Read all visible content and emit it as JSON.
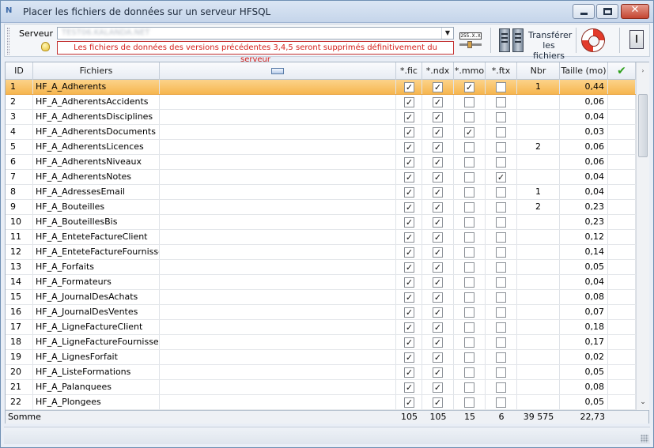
{
  "window": {
    "title": "Placer les fichiers de données sur un serveur HFSQL",
    "icon": "app-icon"
  },
  "toolbar": {
    "server_label": "Serveur",
    "server_value": "TEST06.KALANDA.NET",
    "warning": "Les fichiers de données des versions précédentes 3,4,5 seront supprimés définitivement du serveur",
    "ip_label": "255.X.X",
    "transfer_label_line1": "Transférer",
    "transfer_label_line2": "les fichiers"
  },
  "grid": {
    "columns": {
      "id": "ID",
      "name": "Fichiers",
      "fic": "*.fic",
      "ndx": "*.ndx",
      "mmo": "*.mmo",
      "ftx": "*.ftx",
      "nbr": "Nbr",
      "size": "Taille (mo)"
    },
    "rows": [
      {
        "id": "1",
        "name": "HF_A_Adherents",
        "fic": true,
        "ndx": true,
        "mmo": true,
        "ftx": false,
        "nbr": "1",
        "size": "0,44",
        "selected": true
      },
      {
        "id": "2",
        "name": "HF_A_AdherentsAccidents",
        "fic": true,
        "ndx": true,
        "mmo": false,
        "ftx": false,
        "nbr": "",
        "size": "0,06"
      },
      {
        "id": "3",
        "name": "HF_A_AdherentsDisciplines",
        "fic": true,
        "ndx": true,
        "mmo": false,
        "ftx": false,
        "nbr": "",
        "size": "0,04"
      },
      {
        "id": "4",
        "name": "HF_A_AdherentsDocuments",
        "fic": true,
        "ndx": true,
        "mmo": true,
        "ftx": false,
        "nbr": "",
        "size": "0,03"
      },
      {
        "id": "5",
        "name": "HF_A_AdherentsLicences",
        "fic": true,
        "ndx": true,
        "mmo": false,
        "ftx": false,
        "nbr": "2",
        "size": "0,06"
      },
      {
        "id": "6",
        "name": "HF_A_AdherentsNiveaux",
        "fic": true,
        "ndx": true,
        "mmo": false,
        "ftx": false,
        "nbr": "",
        "size": "0,06"
      },
      {
        "id": "7",
        "name": "HF_A_AdherentsNotes",
        "fic": true,
        "ndx": true,
        "mmo": false,
        "ftx": true,
        "nbr": "",
        "size": "0,04"
      },
      {
        "id": "8",
        "name": "HF_A_AdressesEmail",
        "fic": true,
        "ndx": true,
        "mmo": false,
        "ftx": false,
        "nbr": "1",
        "size": "0,04"
      },
      {
        "id": "9",
        "name": "HF_A_Bouteilles",
        "fic": true,
        "ndx": true,
        "mmo": false,
        "ftx": false,
        "nbr": "2",
        "size": "0,23"
      },
      {
        "id": "10",
        "name": "HF_A_BouteillesBis",
        "fic": true,
        "ndx": true,
        "mmo": false,
        "ftx": false,
        "nbr": "",
        "size": "0,23"
      },
      {
        "id": "11",
        "name": "HF_A_EnteteFactureClient",
        "fic": true,
        "ndx": true,
        "mmo": false,
        "ftx": false,
        "nbr": "",
        "size": "0,12"
      },
      {
        "id": "12",
        "name": "HF_A_EnteteFactureFournisseur",
        "fic": true,
        "ndx": true,
        "mmo": false,
        "ftx": false,
        "nbr": "",
        "size": "0,14"
      },
      {
        "id": "13",
        "name": "HF_A_Forfaits",
        "fic": true,
        "ndx": true,
        "mmo": false,
        "ftx": false,
        "nbr": "",
        "size": "0,05"
      },
      {
        "id": "14",
        "name": "HF_A_Formateurs",
        "fic": true,
        "ndx": true,
        "mmo": false,
        "ftx": false,
        "nbr": "",
        "size": "0,04"
      },
      {
        "id": "15",
        "name": "HF_A_JournalDesAchats",
        "fic": true,
        "ndx": true,
        "mmo": false,
        "ftx": false,
        "nbr": "",
        "size": "0,08"
      },
      {
        "id": "16",
        "name": "HF_A_JournalDesVentes",
        "fic": true,
        "ndx": true,
        "mmo": false,
        "ftx": false,
        "nbr": "",
        "size": "0,07"
      },
      {
        "id": "17",
        "name": "HF_A_LigneFactureClient",
        "fic": true,
        "ndx": true,
        "mmo": false,
        "ftx": false,
        "nbr": "",
        "size": "0,18"
      },
      {
        "id": "18",
        "name": "HF_A_LigneFactureFournisseur",
        "fic": true,
        "ndx": true,
        "mmo": false,
        "ftx": false,
        "nbr": "",
        "size": "0,17"
      },
      {
        "id": "19",
        "name": "HF_A_LignesForfait",
        "fic": true,
        "ndx": true,
        "mmo": false,
        "ftx": false,
        "nbr": "",
        "size": "0,02"
      },
      {
        "id": "20",
        "name": "HF_A_ListeFormations",
        "fic": true,
        "ndx": true,
        "mmo": false,
        "ftx": false,
        "nbr": "",
        "size": "0,05"
      },
      {
        "id": "21",
        "name": "HF_A_Palanquees",
        "fic": true,
        "ndx": true,
        "mmo": false,
        "ftx": false,
        "nbr": "",
        "size": "0,08"
      },
      {
        "id": "22",
        "name": "HF_A_Plongees",
        "fic": true,
        "ndx": true,
        "mmo": false,
        "ftx": false,
        "nbr": "",
        "size": "0,05"
      }
    ],
    "totals": {
      "label": "Somme",
      "fic": "105",
      "ndx": "105",
      "mmo": "15",
      "ftx": "6",
      "nbr": "39 575",
      "size": "22,73"
    }
  },
  "colors": {
    "selection": "#f6b64f",
    "warning_text": "#d4201c",
    "ok_check": "#2fa11d"
  }
}
